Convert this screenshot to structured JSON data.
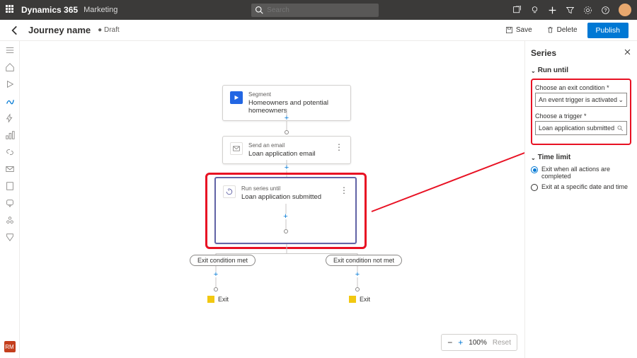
{
  "app": {
    "brand": "Dynamics 365",
    "module": "Marketing",
    "search_placeholder": "Search"
  },
  "header": {
    "title": "Journey name",
    "status": "Draft",
    "save": "Save",
    "delete": "Delete",
    "publish": "Publish"
  },
  "leftrail_badge": "RM",
  "canvas": {
    "segment": {
      "type": "Segment",
      "name": "Homeowners and potential homeowners"
    },
    "email": {
      "type": "Send an email",
      "name": "Loan application email"
    },
    "series": {
      "type": "Run series until",
      "name": "Loan application submitted"
    },
    "branch_left": "Exit condition met",
    "branch_right": "Exit condition not met",
    "exit": "Exit"
  },
  "zoom": {
    "level": "100%",
    "reset": "Reset"
  },
  "panel": {
    "title": "Series",
    "run_until": "Run until",
    "exit_cond_label": "Choose an exit condition *",
    "exit_cond_value": "An event trigger is activated",
    "trigger_label": "Choose a trigger *",
    "trigger_value": "Loan application submitted",
    "time_limit": "Time limit",
    "radio1": "Exit when all actions are completed",
    "radio2": "Exit at a specific date and time"
  }
}
